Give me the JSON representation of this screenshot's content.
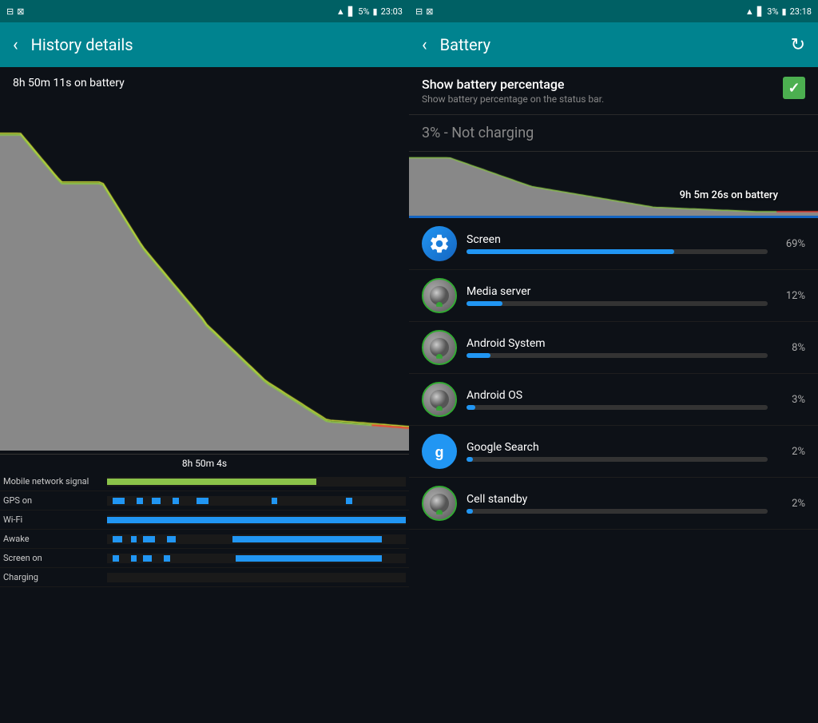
{
  "left": {
    "statusBar": {
      "time": "23:03",
      "battery": "5%",
      "icons": [
        "📱",
        "🔇"
      ]
    },
    "toolbar": {
      "back": "‹",
      "title": "History details"
    },
    "chart": {
      "timeLabel": "8h 50m 11s on battery",
      "bottomLabel": "8h 50m 4s"
    },
    "timeline": {
      "rows": [
        {
          "label": "Mobile network signal",
          "type": "signal"
        },
        {
          "label": "GPS on",
          "type": "gps"
        },
        {
          "label": "Wi-Fi",
          "type": "wifi"
        },
        {
          "label": "Awake",
          "type": "awake"
        },
        {
          "label": "Screen on",
          "type": "screen"
        },
        {
          "label": "Charging",
          "type": "charging"
        }
      ]
    }
  },
  "right": {
    "statusBar": {
      "time": "23:18",
      "battery": "3%"
    },
    "toolbar": {
      "back": "‹",
      "title": "Battery",
      "refreshIcon": "↻"
    },
    "showPercentage": {
      "title": "Show battery percentage",
      "desc": "Show battery percentage on the status bar.",
      "checked": true
    },
    "batteryStatus": "3% - Not charging",
    "chart": {
      "label": "9h 5m 26s on battery"
    },
    "usageItems": [
      {
        "name": "Screen",
        "percent": "69%",
        "value": 69,
        "iconType": "gear"
      },
      {
        "name": "Media server",
        "percent": "12%",
        "value": 12,
        "iconType": "sphere"
      },
      {
        "name": "Android System",
        "percent": "8%",
        "value": 8,
        "iconType": "sphere"
      },
      {
        "name": "Android OS",
        "percent": "3%",
        "value": 3,
        "iconType": "sphere"
      },
      {
        "name": "Google Search",
        "percent": "2%",
        "value": 2,
        "iconType": "google"
      },
      {
        "name": "Cell standby",
        "percent": "2%",
        "value": 2,
        "iconType": "sphere"
      }
    ]
  }
}
